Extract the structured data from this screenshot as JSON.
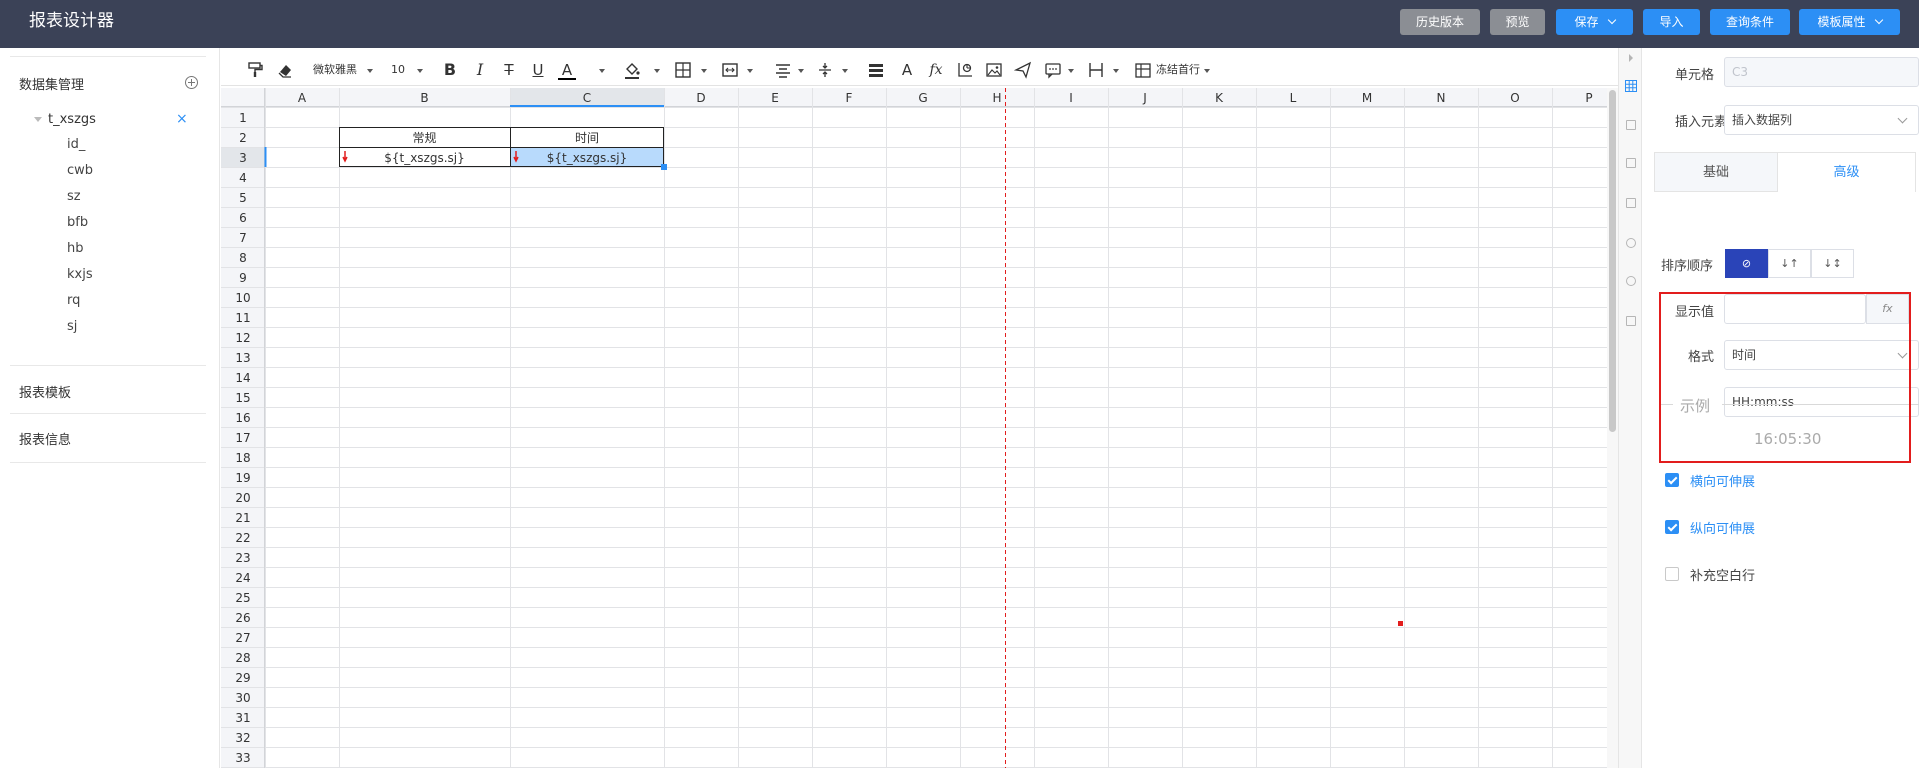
{
  "app": {
    "title": "报表设计器"
  },
  "topbar": {
    "buttons": [
      {
        "label": "历史版本",
        "style": "gray"
      },
      {
        "label": "预览",
        "style": "gray"
      },
      {
        "label": "保存",
        "style": "blue",
        "dropdown": true
      },
      {
        "label": "导入",
        "style": "blue"
      },
      {
        "label": "查询条件",
        "style": "blue"
      },
      {
        "label": "模板属性",
        "style": "blue",
        "dropdown": true
      }
    ]
  },
  "left_panel": {
    "dataset_header": "数据集管理",
    "dataset": {
      "name": "t_xszgs",
      "close": "×",
      "fields": [
        "id_",
        "cwb",
        "sz",
        "bfb",
        "hb",
        "kxjs",
        "rq",
        "sj"
      ]
    },
    "report_template": "报表模板",
    "report_info": "报表信息"
  },
  "toolbar": {
    "font_family": "微软雅黑",
    "font_size": "10",
    "bold": "B",
    "italic": "I",
    "strike": "T",
    "underline": "U",
    "font_color": "A",
    "text_style": "A",
    "formula": "fx",
    "freeze_label": "冻结首行"
  },
  "sheet": {
    "columns": [
      "A",
      "B",
      "C",
      "D",
      "E",
      "F",
      "G",
      "H",
      "I",
      "J",
      "K",
      "L",
      "M",
      "N",
      "O",
      "P"
    ],
    "row_count": 33,
    "cells": {
      "B2": "常规",
      "C2": "时间",
      "B3": "${t_xszgs.sj}",
      "C3": "${t_xszgs.sj}"
    },
    "selected_cell": "C3"
  },
  "right_panel": {
    "cell_label": "单元格",
    "cell_value": "C3",
    "insert_label": "插入元素",
    "insert_value": "插入数据列",
    "tabs": [
      "基础",
      "高级"
    ],
    "active_tab": "高级",
    "sort_label": "排序顺序",
    "sort_options": [
      "⊘",
      "↓↑",
      "↓↕"
    ],
    "display_label": "显示值",
    "display_fx": "fx",
    "format_label": "格式",
    "format_value": "时间",
    "format_pattern": "HH:mm:ss",
    "example_label": "示例",
    "example_value": "16:05:30",
    "checkboxes": [
      {
        "label": "横向可伸展",
        "checked": true
      },
      {
        "label": "纵向可伸展",
        "checked": true
      },
      {
        "label": "补充空白行",
        "checked": false
      }
    ]
  },
  "colors": {
    "topbar": "#3b4257",
    "primary": "#2c8ff5",
    "selection": "#b8dafc",
    "highlight": "#e21d1d",
    "gray_button": "#8b8e94"
  }
}
